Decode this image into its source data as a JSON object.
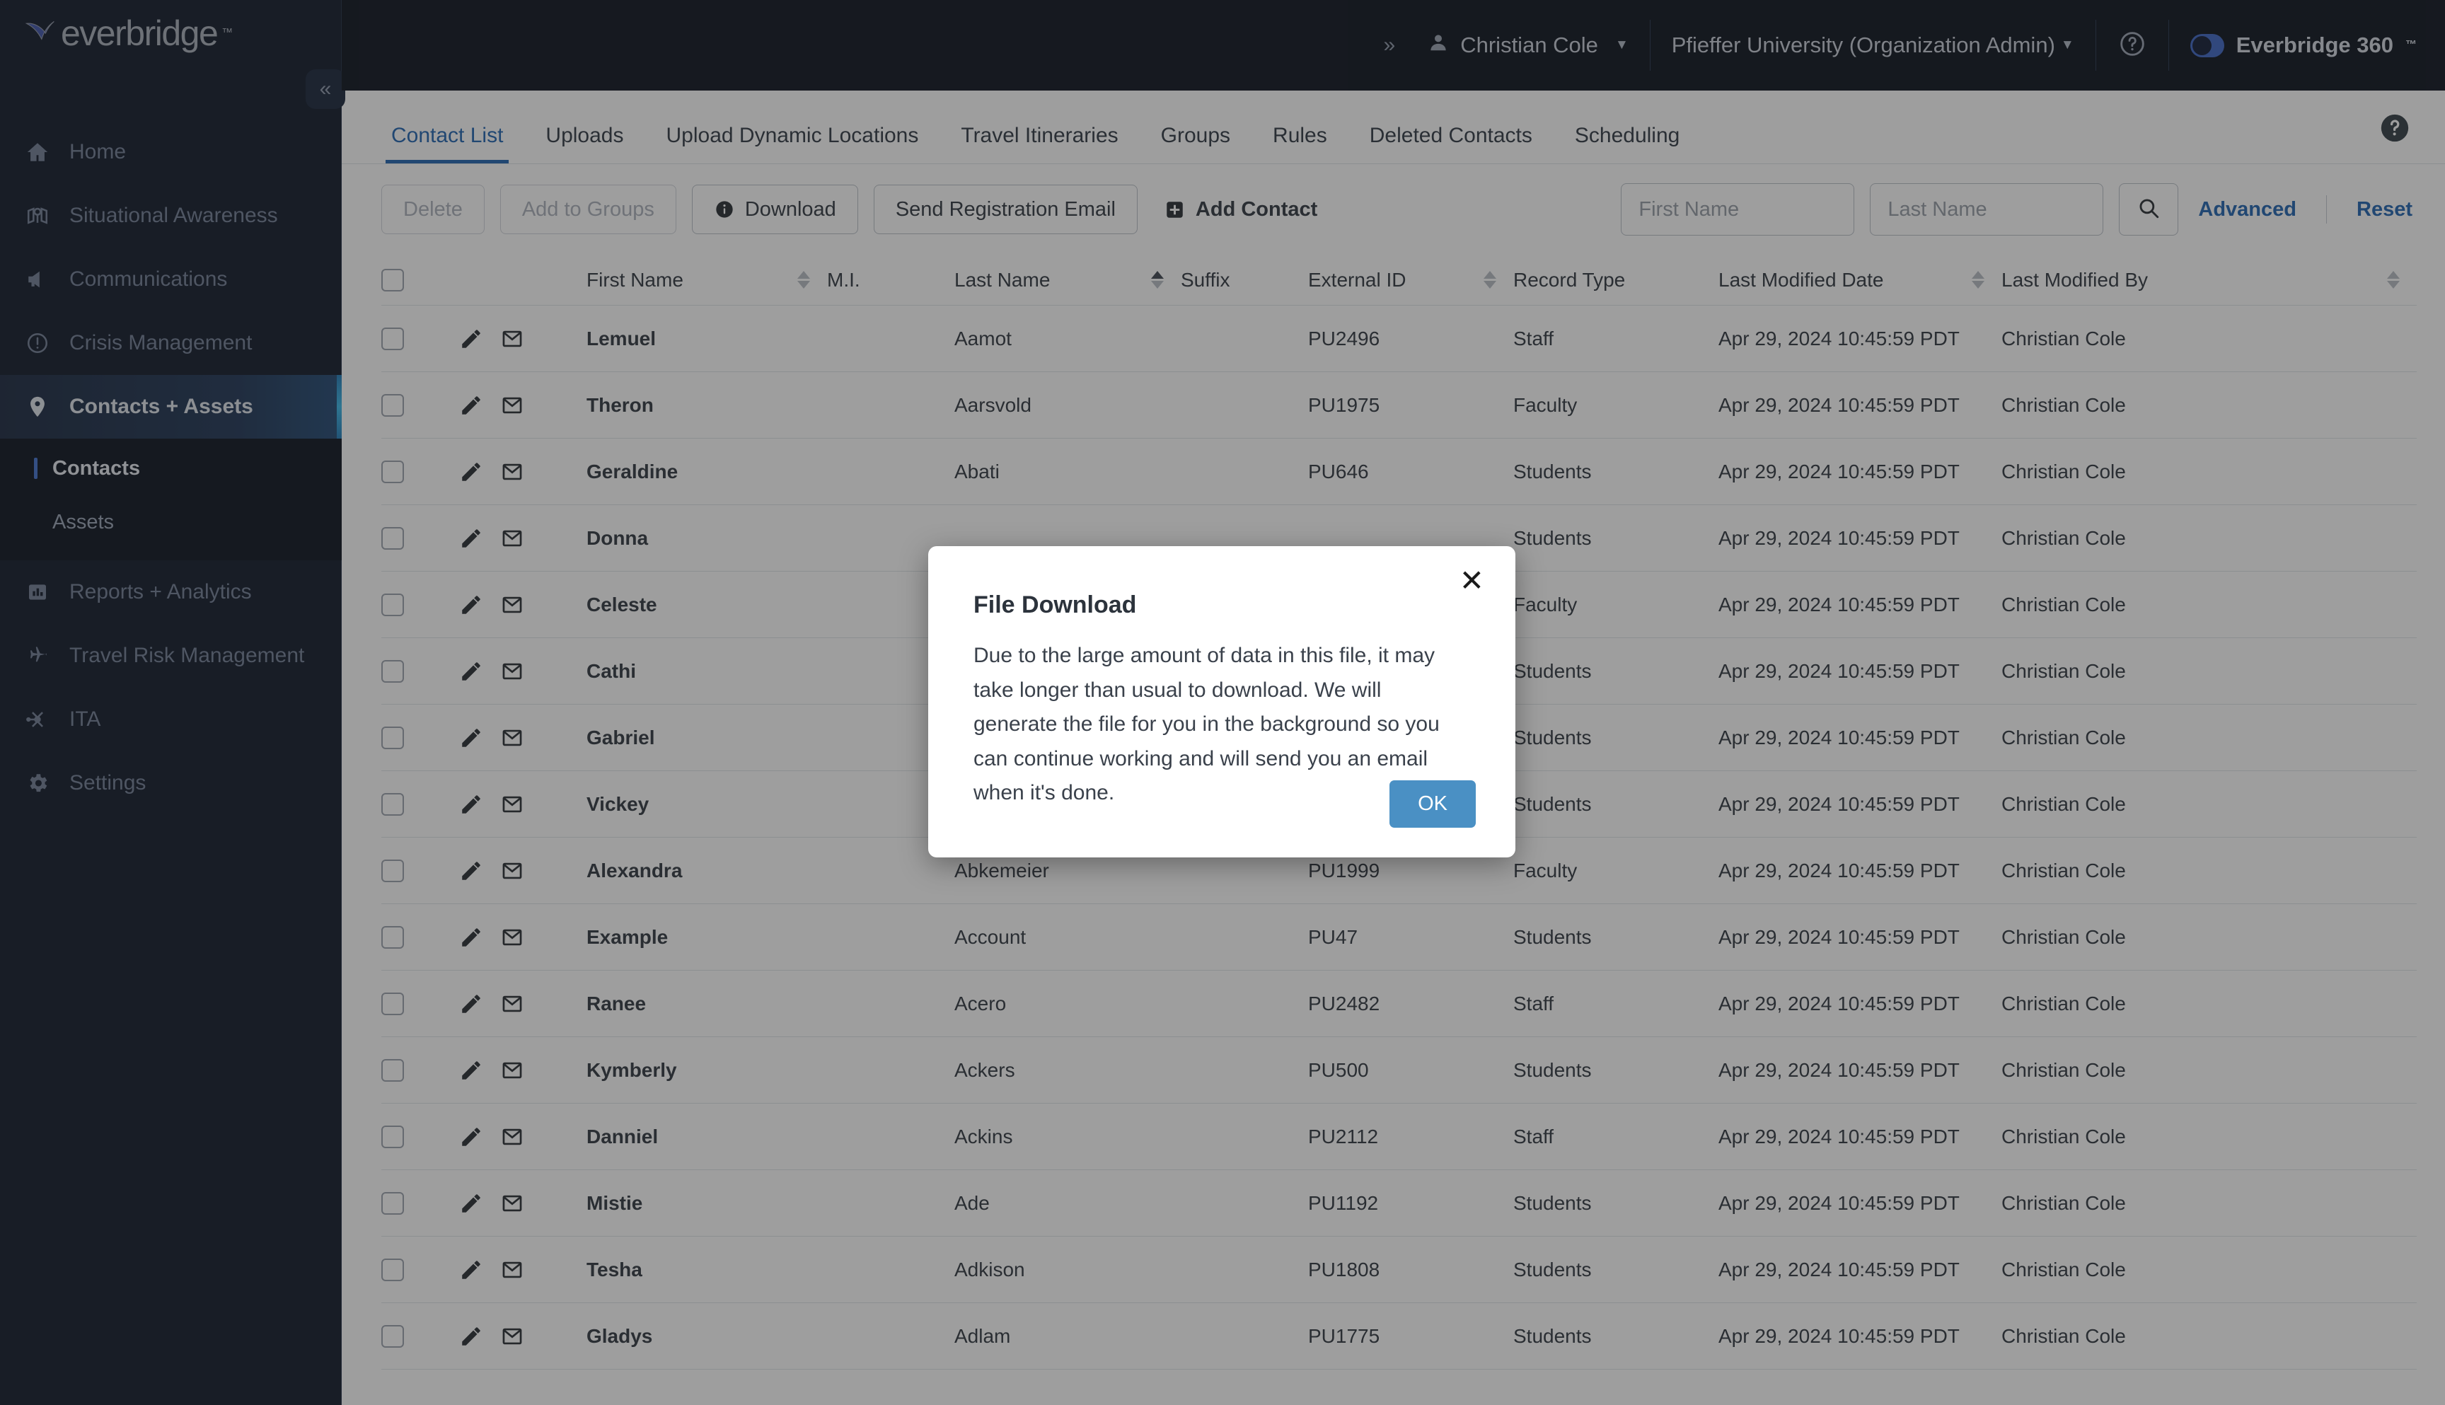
{
  "brand": {
    "logo_text": "everbridge",
    "logo_tm": "™"
  },
  "topbar": {
    "expand_icon": "chevron-double-right-icon",
    "user_name": "Christian Cole",
    "organization": "Pfieffer University (Organization Admin)",
    "help_icon": "help-circle-icon",
    "product_name": "Everbridge 360",
    "product_tm": "™"
  },
  "sidebar": {
    "collapse_icon": "chevron-double-left-icon",
    "items": [
      {
        "label": "Home",
        "icon": "home-icon",
        "active": false
      },
      {
        "label": "Situational Awareness",
        "icon": "map-pin-icon",
        "active": false
      },
      {
        "label": "Communications",
        "icon": "megaphone-icon",
        "active": false
      },
      {
        "label": "Crisis Management",
        "icon": "alert-circle-icon",
        "active": false
      },
      {
        "label": "Contacts + Assets",
        "icon": "location-pin-icon",
        "active": true
      },
      {
        "label": "Reports + Analytics",
        "icon": "bar-chart-icon",
        "active": false
      },
      {
        "label": "Travel Risk Management",
        "icon": "airplane-icon",
        "active": false
      },
      {
        "label": "ITA",
        "icon": "network-nodes-icon",
        "active": false
      },
      {
        "label": "Settings",
        "icon": "gear-icon",
        "active": false
      }
    ],
    "sub_items": [
      {
        "label": "Contacts",
        "active": true
      },
      {
        "label": "Assets",
        "active": false
      }
    ]
  },
  "tabs": [
    {
      "label": "Contact List",
      "active": true
    },
    {
      "label": "Uploads",
      "active": false
    },
    {
      "label": "Upload Dynamic Locations",
      "active": false
    },
    {
      "label": "Travel Itineraries",
      "active": false
    },
    {
      "label": "Groups",
      "active": false
    },
    {
      "label": "Rules",
      "active": false
    },
    {
      "label": "Deleted Contacts",
      "active": false
    },
    {
      "label": "Scheduling",
      "active": false
    }
  ],
  "page_help_icon": "help-circle-icon",
  "toolbar": {
    "delete_label": "Delete",
    "add_to_groups_label": "Add to Groups",
    "download_label": "Download",
    "download_icon": "info-circle-icon",
    "send_registration_label": "Send Registration Email",
    "add_contact_label": "Add Contact",
    "add_contact_icon": "plus-square-icon",
    "first_name_placeholder": "First Name",
    "first_name_value": "",
    "last_name_placeholder": "Last Name",
    "last_name_value": "",
    "search_icon": "search-icon",
    "advanced_label": "Advanced",
    "reset_label": "Reset"
  },
  "table": {
    "columns": [
      {
        "key": "first_name",
        "label": "First Name",
        "sortable": true,
        "sort": "none"
      },
      {
        "key": "mi",
        "label": "M.I.",
        "sortable": false,
        "sort": "none"
      },
      {
        "key": "last_name",
        "label": "Last Name",
        "sortable": true,
        "sort": "asc"
      },
      {
        "key": "suffix",
        "label": "Suffix",
        "sortable": false,
        "sort": "none"
      },
      {
        "key": "external_id",
        "label": "External ID",
        "sortable": true,
        "sort": "none"
      },
      {
        "key": "record_type",
        "label": "Record Type",
        "sortable": false,
        "sort": "none"
      },
      {
        "key": "last_modified_date",
        "label": "Last Modified Date",
        "sortable": true,
        "sort": "none"
      },
      {
        "key": "last_modified_by",
        "label": "Last Modified By",
        "sortable": true,
        "sort": "none"
      }
    ],
    "row_icons": {
      "edit": "pencil-icon",
      "email": "envelope-icon"
    },
    "rows": [
      {
        "first_name": "Lemuel",
        "mi": "",
        "last_name": "Aamot",
        "suffix": "",
        "external_id": "PU2496",
        "record_type": "Staff",
        "last_modified_date": "Apr 29, 2024 10:45:59 PDT",
        "last_modified_by": "Christian Cole"
      },
      {
        "first_name": "Theron",
        "mi": "",
        "last_name": "Aarsvold",
        "suffix": "",
        "external_id": "PU1975",
        "record_type": "Faculty",
        "last_modified_date": "Apr 29, 2024 10:45:59 PDT",
        "last_modified_by": "Christian Cole"
      },
      {
        "first_name": "Geraldine",
        "mi": "",
        "last_name": "Abati",
        "suffix": "",
        "external_id": "PU646",
        "record_type": "Students",
        "last_modified_date": "Apr 29, 2024 10:45:59 PDT",
        "last_modified_by": "Christian Cole"
      },
      {
        "first_name": "Donna",
        "mi": "",
        "last_name": "",
        "suffix": "",
        "external_id": "",
        "record_type": "Students",
        "last_modified_date": "Apr 29, 2024 10:45:59 PDT",
        "last_modified_by": "Christian Cole"
      },
      {
        "first_name": "Celeste",
        "mi": "",
        "last_name": "",
        "suffix": "",
        "external_id": "",
        "record_type": "Faculty",
        "last_modified_date": "Apr 29, 2024 10:45:59 PDT",
        "last_modified_by": "Christian Cole"
      },
      {
        "first_name": "Cathi",
        "mi": "",
        "last_name": "",
        "suffix": "",
        "external_id": "",
        "record_type": "Students",
        "last_modified_date": "Apr 29, 2024 10:45:59 PDT",
        "last_modified_by": "Christian Cole"
      },
      {
        "first_name": "Gabriel",
        "mi": "",
        "last_name": "",
        "suffix": "",
        "external_id": "",
        "record_type": "Students",
        "last_modified_date": "Apr 29, 2024 10:45:59 PDT",
        "last_modified_by": "Christian Cole"
      },
      {
        "first_name": "Vickey",
        "mi": "",
        "last_name": "",
        "suffix": "",
        "external_id": "",
        "record_type": "Students",
        "last_modified_date": "Apr 29, 2024 10:45:59 PDT",
        "last_modified_by": "Christian Cole"
      },
      {
        "first_name": "Alexandra",
        "mi": "",
        "last_name": "Abkemeier",
        "suffix": "",
        "external_id": "PU1999",
        "record_type": "Faculty",
        "last_modified_date": "Apr 29, 2024 10:45:59 PDT",
        "last_modified_by": "Christian Cole"
      },
      {
        "first_name": "Example",
        "mi": "",
        "last_name": "Account",
        "suffix": "",
        "external_id": "PU47",
        "record_type": "Students",
        "last_modified_date": "Apr 29, 2024 10:45:59 PDT",
        "last_modified_by": "Christian Cole"
      },
      {
        "first_name": "Ranee",
        "mi": "",
        "last_name": "Acero",
        "suffix": "",
        "external_id": "PU2482",
        "record_type": "Staff",
        "last_modified_date": "Apr 29, 2024 10:45:59 PDT",
        "last_modified_by": "Christian Cole"
      },
      {
        "first_name": "Kymberly",
        "mi": "",
        "last_name": "Ackers",
        "suffix": "",
        "external_id": "PU500",
        "record_type": "Students",
        "last_modified_date": "Apr 29, 2024 10:45:59 PDT",
        "last_modified_by": "Christian Cole"
      },
      {
        "first_name": "Danniel",
        "mi": "",
        "last_name": "Ackins",
        "suffix": "",
        "external_id": "PU2112",
        "record_type": "Staff",
        "last_modified_date": "Apr 29, 2024 10:45:59 PDT",
        "last_modified_by": "Christian Cole"
      },
      {
        "first_name": "Mistie",
        "mi": "",
        "last_name": "Ade",
        "suffix": "",
        "external_id": "PU1192",
        "record_type": "Students",
        "last_modified_date": "Apr 29, 2024 10:45:59 PDT",
        "last_modified_by": "Christian Cole"
      },
      {
        "first_name": "Tesha",
        "mi": "",
        "last_name": "Adkison",
        "suffix": "",
        "external_id": "PU1808",
        "record_type": "Students",
        "last_modified_date": "Apr 29, 2024 10:45:59 PDT",
        "last_modified_by": "Christian Cole"
      },
      {
        "first_name": "Gladys",
        "mi": "",
        "last_name": "Adlam",
        "suffix": "",
        "external_id": "PU1775",
        "record_type": "Students",
        "last_modified_date": "Apr 29, 2024 10:45:59 PDT",
        "last_modified_by": "Christian Cole"
      }
    ]
  },
  "modal": {
    "title": "File Download",
    "body": "Due to the large amount of data in this file, it may take longer than usual to download. We will generate the file for you in the background so you can continue working and will send you an email when it's done.",
    "ok_label": "OK",
    "close_icon": "close-x-icon",
    "accent_color": "#4a90c4"
  }
}
